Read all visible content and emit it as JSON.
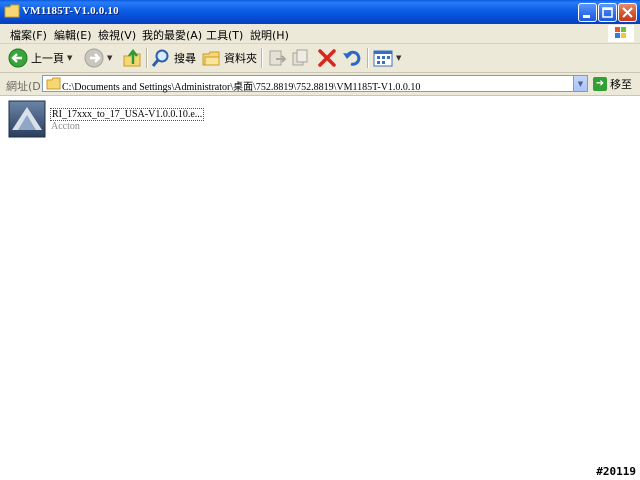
{
  "window": {
    "title": "VM1185T-V1.0.0.10"
  },
  "menu": {
    "items": [
      "檔案(F)",
      "編輯(E)",
      "檢視(V)",
      "我的最愛(A)",
      "工具(T)",
      "說明(H)"
    ]
  },
  "toolbar": {
    "back_label": "上一頁",
    "search_label": "搜尋",
    "folders_label": "資料夾"
  },
  "address": {
    "label": "網址(D)",
    "path": "C:\\Documents and Settings\\Administrator\\桌面\\752.8819\\752.8819\\VM1185T-V1.0.0.10",
    "go_label": "移至"
  },
  "files": [
    {
      "name": "RI_17xxx_to_17_USA-V1.0.0.10.e...",
      "company": "Accton"
    }
  ],
  "watermark": "#20119"
}
